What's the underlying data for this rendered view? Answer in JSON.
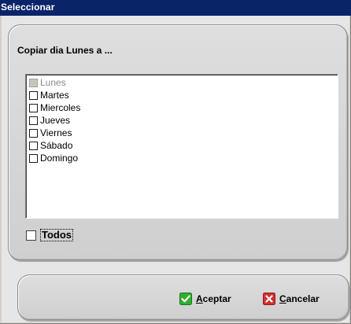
{
  "window": {
    "title": "Seleccionar"
  },
  "panel": {
    "heading": "Copiar dia Lunes a ..."
  },
  "days": [
    {
      "label": "Lunes",
      "checked": false,
      "disabled": true
    },
    {
      "label": "Martes",
      "checked": false,
      "disabled": false
    },
    {
      "label": "Miercoles",
      "checked": false,
      "disabled": false
    },
    {
      "label": "Jueves",
      "checked": false,
      "disabled": false
    },
    {
      "label": "Viernes",
      "checked": false,
      "disabled": false
    },
    {
      "label": "Sábado",
      "checked": false,
      "disabled": false
    },
    {
      "label": "Domingo",
      "checked": false,
      "disabled": false
    }
  ],
  "todos": {
    "label": "Todos",
    "checked": false
  },
  "buttons": {
    "accept": {
      "first": "A",
      "rest": "ceptar",
      "icon": "checkmark-icon",
      "color": "#2fae2f"
    },
    "cancel": {
      "first": "C",
      "rest": "ancelar",
      "icon": "x-icon",
      "color": "#d23030"
    }
  }
}
